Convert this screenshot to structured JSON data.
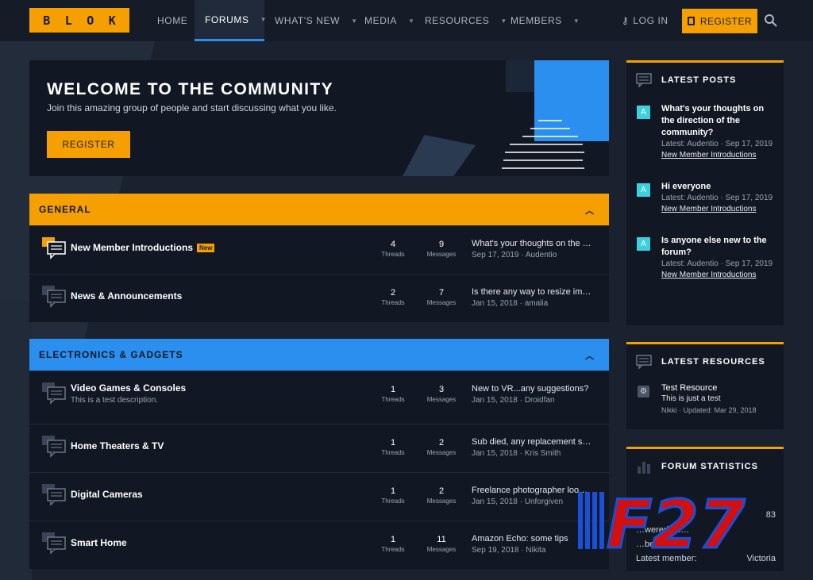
{
  "logo": {
    "letters": [
      "B",
      "L",
      "O",
      "K"
    ]
  },
  "nav": {
    "items": [
      {
        "label": "HOME",
        "caret": false
      },
      {
        "label": "FORUMS",
        "caret": true
      },
      {
        "label": "WHAT'S NEW",
        "caret": true
      },
      {
        "label": "MEDIA",
        "caret": true
      },
      {
        "label": "RESOURCES",
        "caret": true
      },
      {
        "label": "MEMBERS",
        "caret": true
      }
    ],
    "active": "FORUMS",
    "login": "LOG IN",
    "register": "REGISTER"
  },
  "welcome": {
    "title": "WELCOME TO THE COMMUNITY",
    "subtitle": "Join this amazing group of people and start discussing what you like.",
    "button": "REGISTER"
  },
  "sections": [
    {
      "title": "GENERAL",
      "color": "#f5a000",
      "forums": [
        {
          "name": "New Member Introductions",
          "badge": "New",
          "desc": "",
          "threads": "4",
          "messages": "9",
          "last_title": "What's your thoughts on the …",
          "last_date": "Sep 17, 2019",
          "last_user": "Audentio",
          "unread": true
        },
        {
          "name": "News & Announcements",
          "badge": "",
          "desc": "",
          "threads": "2",
          "messages": "7",
          "last_title": "Is there any way to resize im…",
          "last_date": "Jan 15, 2018",
          "last_user": "amalia",
          "unread": false
        }
      ]
    },
    {
      "title": "ELECTRONICS & GADGETS",
      "color": "#2b8ff0",
      "forums": [
        {
          "name": "Video Games & Consoles",
          "badge": "",
          "desc": "This is a test description.",
          "threads": "1",
          "messages": "3",
          "last_title": "New to VR...any suggestions?",
          "last_date": "Jan 15, 2018",
          "last_user": "Droidfan",
          "unread": false
        },
        {
          "name": "Home Theaters & TV",
          "badge": "",
          "desc": "",
          "threads": "1",
          "messages": "2",
          "last_title": "Sub died, any replacement s…",
          "last_date": "Jan 15, 2018",
          "last_user": "Kris Smith",
          "unread": false
        },
        {
          "name": "Digital Cameras",
          "badge": "",
          "desc": "",
          "threads": "1",
          "messages": "2",
          "last_title": "Freelance photographer loo…",
          "last_date": "Jan 15, 2018",
          "last_user": "Unforgiven",
          "unread": false
        },
        {
          "name": "Smart Home",
          "badge": "",
          "desc": "",
          "threads": "1",
          "messages": "11",
          "last_title": "Amazon Echo: some tips",
          "last_date": "Sep 19, 2018",
          "last_user": "Nikita",
          "unread": false
        }
      ]
    }
  ],
  "labels": {
    "threads": "Threads",
    "messages": "Messages",
    "sep": " · "
  },
  "latest_posts": {
    "title": "LATEST POSTS",
    "items": [
      {
        "avatar": "A",
        "title": "What's your thoughts on the direction of the community?",
        "meta": "Latest: Audentio · Sep 17, 2019",
        "forum": "New Member Introductions"
      },
      {
        "avatar": "A",
        "title": "Hi everyone",
        "meta": "Latest: Audentio · Sep 17, 2019",
        "forum": "New Member Introductions"
      },
      {
        "avatar": "A",
        "title": "Is anyone else new to the forum?",
        "meta": "Latest: Audentio · Sep 17, 2019",
        "forum": "New Member Introductions"
      }
    ]
  },
  "latest_resources": {
    "title": "LATEST RESOURCES",
    "items": [
      {
        "title": "Test Resource",
        "desc": "This is just a test",
        "meta": "Nikki · Updated: Mar 29, 2018"
      }
    ]
  },
  "forum_stats": {
    "title": "FORUM STATISTICS",
    "rows": [
      {
        "label": "",
        "value": "83"
      },
      {
        "label": "…wered qu…",
        "value": ""
      },
      {
        "label": "…bers:",
        "value": ""
      },
      {
        "label": "Latest member:",
        "value": "Victoria"
      }
    ]
  },
  "watermark": {
    "text": "F27"
  }
}
